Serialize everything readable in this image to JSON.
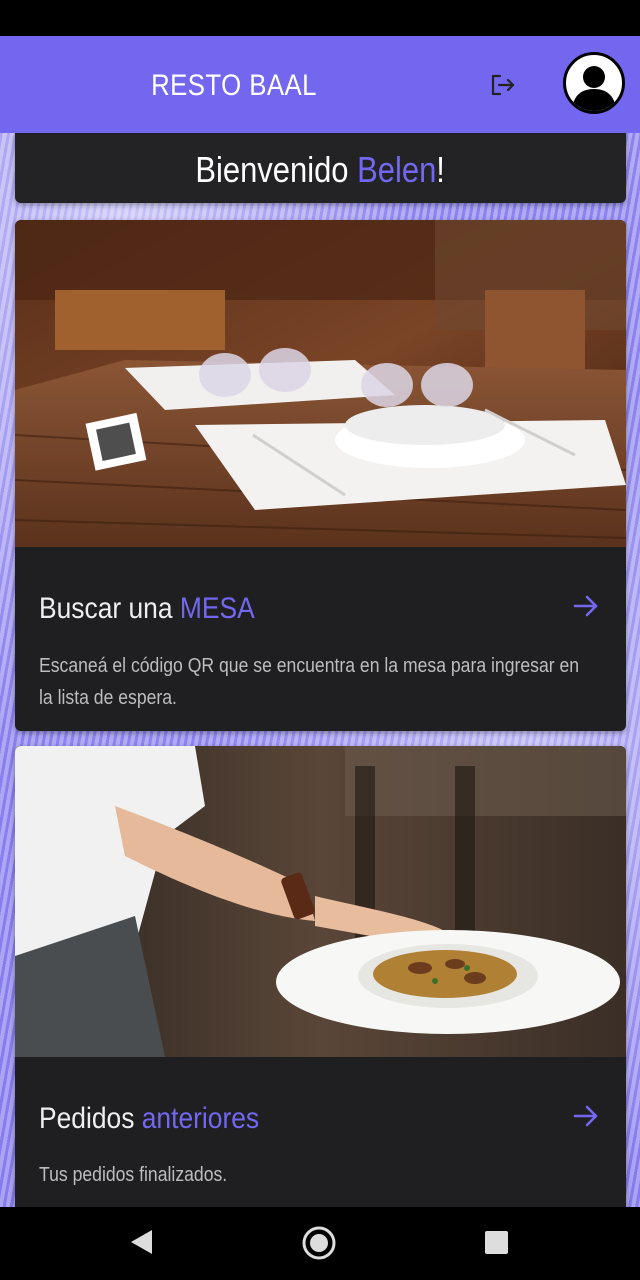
{
  "app_bar": {
    "title": "RESTO BAAL",
    "logout_icon": "logout-icon",
    "avatar_icon": "user-avatar-icon",
    "color": "#7367f0"
  },
  "welcome": {
    "prefix": "Bienvenido ",
    "name": "Belen",
    "suffix": "!"
  },
  "cards": [
    {
      "title_prefix": "Buscar una ",
      "title_accent": "MESA",
      "description": "Escaneá el código QR que se encuentra en la mesa para ingresar en la lista de espera.",
      "image": "restaurant-table-with-qr-code",
      "action_icon": "arrow-right-icon"
    },
    {
      "title_prefix": "Pedidos ",
      "title_accent": "anteriores",
      "description": "Tus pedidos finalizados.",
      "image": "waiter-serving-pasta-plate",
      "action_icon": "arrow-right-icon"
    }
  ],
  "nav": {
    "back_icon": "back-triangle-icon",
    "home_icon": "home-circle-icon",
    "recents_icon": "recents-square-icon"
  }
}
